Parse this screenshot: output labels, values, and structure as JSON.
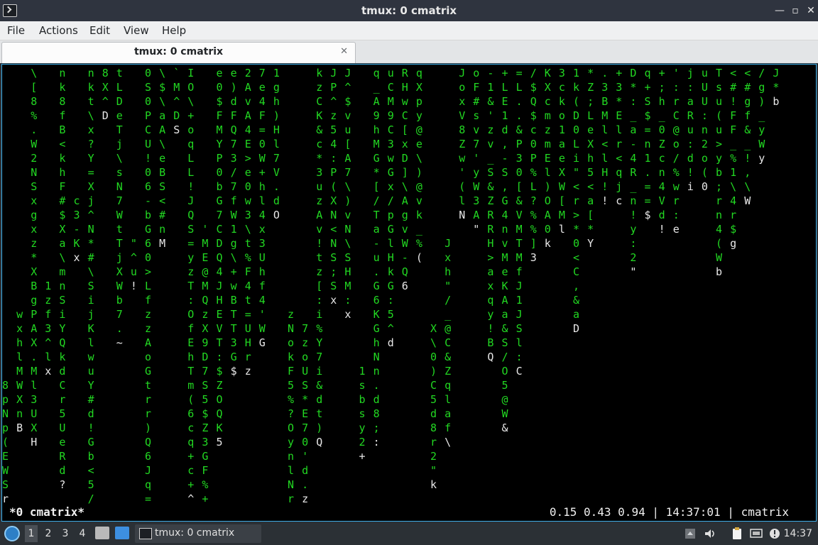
{
  "window": {
    "title": "tmux: 0 cmatrix"
  },
  "menu": [
    "File",
    "Actions",
    "Edit",
    "View",
    "Help"
  ],
  "tab": {
    "label": "tmux: 0 cmatrix"
  },
  "matrix_columns": [
    {
      "c": 0,
      "r": 22,
      "t": "8pNp(EWSr"
    },
    {
      "c": 1,
      "r": 17,
      "t": "wxhlMWXnB"
    },
    {
      "c": 2,
      "r": 0,
      "t": "\\[8%.W2NSxgxz*XBgPAX.Ml3UXH"
    },
    {
      "c": 3,
      "r": 15,
      "t": "1zf3^lx"
    },
    {
      "c": 4,
      "r": 0,
      "t": "nk8fB<khF#$Xa\\mnSiYQkdCr5UeRd?"
    },
    {
      "c": 5,
      "r": 9,
      "t": "c3-Kx"
    },
    {
      "c": 6,
      "r": 0,
      "t": "nkt\\x?Y=Xj^N*#\\SijKlwuY#d!Gb<5/QoR%#"
    },
    {
      "c": 7,
      "r": 0,
      "t": "8X^D"
    },
    {
      "c": 8,
      "r": 0,
      "t": "tLDeTj\\sN7WtTjXWb7.~"
    },
    {
      "c": 9,
      "r": 12,
      "t": "\"^u!"
    },
    {
      "c": 10,
      "r": 0,
      "t": "0S0PCU!06-bG60>LfzzAoGtrr)Q6Jq=S+%"
    },
    {
      "c": 11,
      "r": 0,
      "t": "\\$\\aA\\eBS<#nM"
    },
    {
      "c": 12,
      "r": 0,
      "t": "`M^DS"
    },
    {
      "c": 13,
      "r": 0,
      "t": "IO\\+oqLL!JQS=yzT:OfEhTm(6cq+c+^"
    },
    {
      "c": 14,
      "r": 11,
      "t": "'ME@MQzX9D7S5$Z3GF%+(c"
    },
    {
      "c": 15,
      "r": 0,
      "t": "e0$FMYP0bG7CDQ4JHEVT:$ZOQK5"
    },
    {
      "c": 16,
      "r": 0,
      "t": "e)dFQ73/7fW1g\\+wBTT3G$"
    },
    {
      "c": 17,
      "r": 0,
      "t": "2AvA4E>e0w3\\t%F4t=UHrz"
    },
    {
      "c": 18,
      "r": 0,
      "t": "7e4F=0W+hl4x3Uhf4'WG"
    },
    {
      "c": 19,
      "r": 0,
      "t": "1gh)Hl7V.dO"
    },
    {
      "c": 20,
      "r": 17,
      "t": "zNokF5%?OynlNr:t"
    },
    {
      "c": 21,
      "r": 18,
      "t": "7zoUS*E70'd.z"
    },
    {
      "c": 22,
      "r": 0,
      "t": "kzCK&c*3uzAv!tz[:i%Y7i&dt)Q"
    },
    {
      "c": 23,
      "r": 0,
      "t": "JP^z54:P(XN<NS;Sx"
    },
    {
      "c": 24,
      "r": 0,
      "t": "J^$vu[A7\\)vN\\SHM:x"
    },
    {
      "c": 25,
      "r": 21,
      "t": "1sbsy2+"
    },
    {
      "c": 26,
      "r": 0,
      "t": "q_A9hMG*[/Ta-u.G6KGhNn.d8;:"
    },
    {
      "c": 27,
      "r": 0,
      "t": "uCM9C3wGx/pGlHkG:5^d"
    },
    {
      "c": 28,
      "r": 0,
      "t": "RHwC[xD]\\AgvW-Q6"
    },
    {
      "c": 29,
      "r": 0,
      "t": "qXpy@e\\)@vk_%("
    },
    {
      "c": 30,
      "r": 18,
      "t": "X\\0)C5d8r2\"k"
    },
    {
      "c": 31,
      "r": 12,
      "t": "Jxh\"/_@C&Zqlaf\\"
    },
    {
      "c": 32,
      "r": 0,
      "t": "JoxV8Zw'(lN"
    },
    {
      "c": 33,
      "r": 0,
      "t": "oF#sv7'yW3A\""
    },
    {
      "c": 34,
      "r": 0,
      "t": "-1&'zv_S&ZRRH>axqy!BQ"
    },
    {
      "c": 35,
      "r": 0,
      "t": "+LE1d,-S,G4nvMeKAa&S/O5@W&"
    },
    {
      "c": 36,
      "r": 0,
      "t": "=L..&P30[&VMTMfJ1JSl:C"
    },
    {
      "c": 37,
      "r": 0,
      "t": "/$Q$c0P%L?%%]3"
    },
    {
      "c": 38,
      "r": 0,
      "t": "KXcmzmEl)OA0k"
    },
    {
      "c": 39,
      "r": 0,
      "t": "3cko1aeXW[Ml"
    },
    {
      "c": 40,
      "r": 0,
      "t": "1k(D0Li\"<r>*0<C,&aD"
    },
    {
      "c": 41,
      "r": 0,
      "t": "*Z;LeXh5<a[*Y"
    },
    {
      "c": 42,
      "r": 0,
      "t": ".3BMl<lH!!"
    },
    {
      "c": 43,
      "r": 0,
      "t": "+3*Elr<qjc"
    },
    {
      "c": 44,
      "r": 0,
      "t": "D*:_a-4R_n!y:2\""
    },
    {
      "c": 45,
      "r": 0,
      "t": "q+S$=n1.==$"
    },
    {
      "c": 46,
      "r": 0,
      "t": "+;h_0Zcn4Vd!"
    },
    {
      "c": 47,
      "r": 0,
      "t": "':rC@o/%wr:e"
    },
    {
      "c": 48,
      "r": 0,
      "t": "j:aRu:d!i"
    },
    {
      "c": 49,
      "r": 0,
      "t": "uUU:n2o(0"
    },
    {
      "c": 50,
      "r": 0,
      "t": "Tsu(u>yb;rn4(Wb"
    },
    {
      "c": 51,
      "r": 0,
      "t": "<#!FF_%1\\4r$g"
    },
    {
      "c": 52,
      "r": 0,
      "t": "<#gf&_!,\\W"
    },
    {
      "c": 53,
      "r": 0,
      "t": "/g)_yWy"
    },
    {
      "c": 54,
      "r": 0,
      "t": "J*b"
    }
  ],
  "statusbar": {
    "left": "*0 cmatrix*",
    "right": "0.15 0.43 0.94 | 14:37:01 | cmatrix"
  },
  "taskbar": {
    "workspaces": [
      "1",
      "2",
      "3",
      "4"
    ],
    "task_label": "tmux: 0 cmatrix",
    "clock": "14:37"
  },
  "colors": {
    "matrix_green": "#22d822",
    "matrix_white": "#e8e8e8",
    "terminal_bg": "#000000",
    "accent": "#3daee9"
  }
}
